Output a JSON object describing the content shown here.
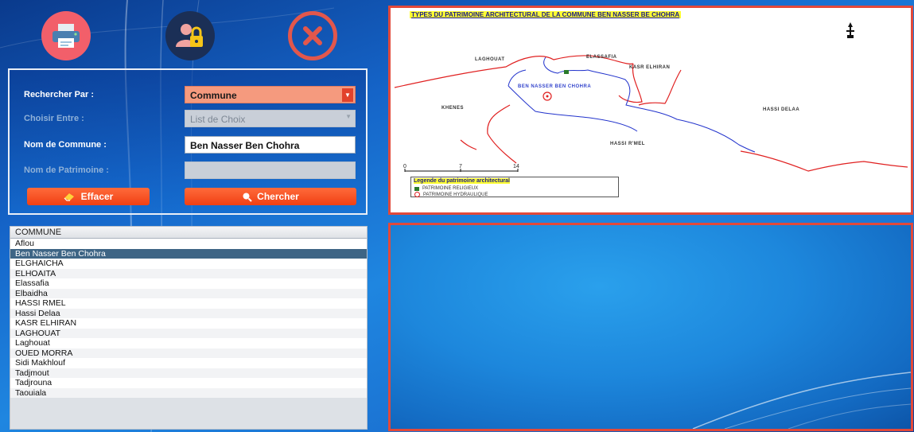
{
  "toolbar": {
    "print_icon": "printer-icon",
    "lock_icon": "user-lock-icon",
    "close_icon": "close-icon"
  },
  "search": {
    "search_by_label": "Rechercher Par :",
    "search_by_value": "Commune",
    "choose_label": "Choisir Entre :",
    "choose_value": "List de Choix",
    "commune_name_label": "Nom de Commune :",
    "commune_name_value": "Ben Nasser Ben Chohra",
    "heritage_name_label": "Nom de Patrimoine :",
    "heritage_name_value": "",
    "clear_label": "Effacer",
    "search_label": "Chercher"
  },
  "commune_list": {
    "header": "COMMUNE",
    "items": [
      "Aflou",
      "Ben Nasser Ben Chohra",
      "ELGHAICHA",
      "ELHOAITA",
      "Elassafia",
      "Elbaidha",
      "HASSI RMEL",
      "Hassi Delaa",
      "KASR ELHIRAN",
      "LAGHOUAT",
      "Laghouat",
      "OUED MORRA",
      "Sidi Makhlouf",
      "Tadjmout",
      "Tadjrouna",
      "Taouiala"
    ],
    "selected": "Ben Nasser Ben Chohra"
  },
  "map": {
    "title": "TYPES DU PATRIMOINE ARCHITECTURAL DE LA COMMUNE BEN NASSER BE CHOHRA",
    "labels": {
      "laghouat": "LAGHOUAT",
      "elassafia": "ELASSAFIA",
      "kasr": "KASR ELHIRAN",
      "ben_nasser": "BEN NASSER BEN CHOHRA",
      "khenes": "KHENES",
      "hassi_delaa": "HASSI DELAA",
      "hassi_rmel": "HASSI R'MEL"
    },
    "scale": [
      "0",
      "7",
      "14"
    ],
    "legend": {
      "title": "Legende du patrimoine architectural",
      "religious": "PATRIMOINE RELIGIEUX",
      "hydraulic": "PATRIMOINE HYDRAULIQUE"
    },
    "colors": {
      "commune_border": "#2233cc",
      "neighbor_border": "#e02020",
      "panel_border": "#e2493a",
      "highlight": "#ffff33"
    }
  }
}
